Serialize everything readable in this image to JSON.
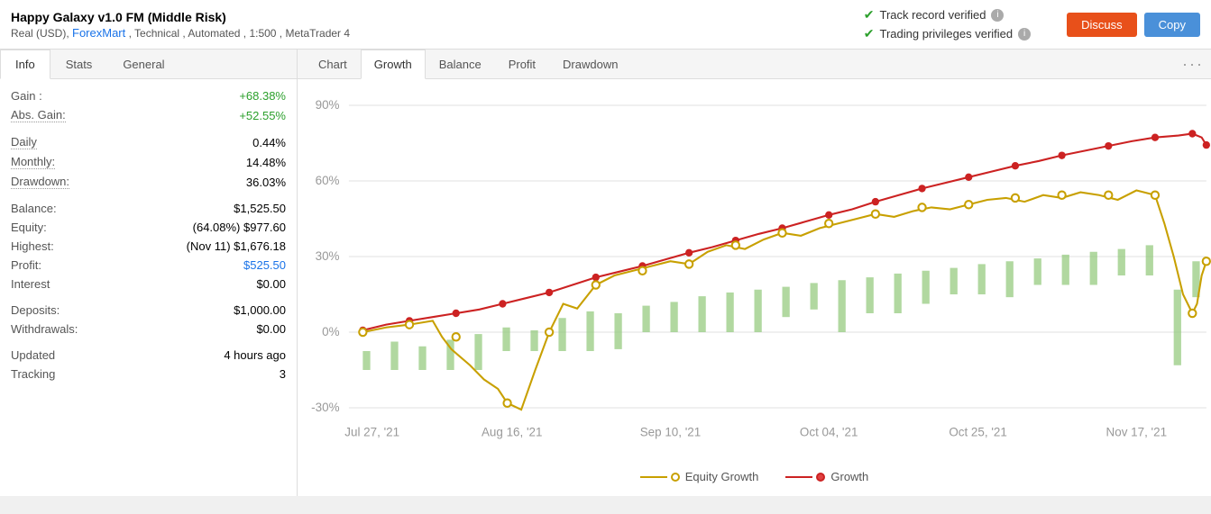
{
  "header": {
    "title": "Happy Galaxy v1.0 FM (Middle Risk)",
    "subtitle": "Real (USD), ForexMart , Technical , Automated , 1:500 , MetaTrader 4",
    "verified1": "Track record verified",
    "verified2": "Trading privileges verified",
    "btn_discuss": "Discuss",
    "btn_copy": "Copy"
  },
  "left": {
    "tabs": [
      "Info",
      "Stats",
      "General"
    ],
    "active_tab": "Info",
    "stats": {
      "gain_label": "Gain :",
      "gain_value": "+68.38%",
      "abs_gain_label": "Abs. Gain:",
      "abs_gain_value": "+52.55%",
      "daily_label": "Daily",
      "daily_value": "0.44%",
      "monthly_label": "Monthly:",
      "monthly_value": "14.48%",
      "drawdown_label": "Drawdown:",
      "drawdown_value": "36.03%",
      "balance_label": "Balance:",
      "balance_value": "$1,525.50",
      "equity_label": "Equity:",
      "equity_value": "(64.08%) $977.60",
      "highest_label": "Highest:",
      "highest_value": "(Nov 11) $1,676.18",
      "profit_label": "Profit:",
      "profit_value": "$525.50",
      "interest_label": "Interest",
      "interest_value": "$0.00",
      "deposits_label": "Deposits:",
      "deposits_value": "$1,000.00",
      "withdrawals_label": "Withdrawals:",
      "withdrawals_value": "$0.00",
      "updated_label": "Updated",
      "updated_value": "4 hours ago",
      "tracking_label": "Tracking",
      "tracking_value": "3"
    }
  },
  "chart": {
    "tabs": [
      "Chart",
      "Growth",
      "Balance",
      "Profit",
      "Drawdown"
    ],
    "active_tab": "Growth",
    "more_icon": "···",
    "legend_equity": "Equity Growth",
    "legend_growth": "Growth",
    "x_labels": [
      "Jul 27, '21",
      "Aug 16, '21",
      "Sep 10, '21",
      "Oct 04, '21",
      "Oct 25, '21",
      "Nov 17, '21"
    ],
    "y_labels": [
      "-30%",
      "0%",
      "30%",
      "60%",
      "90%"
    ]
  }
}
